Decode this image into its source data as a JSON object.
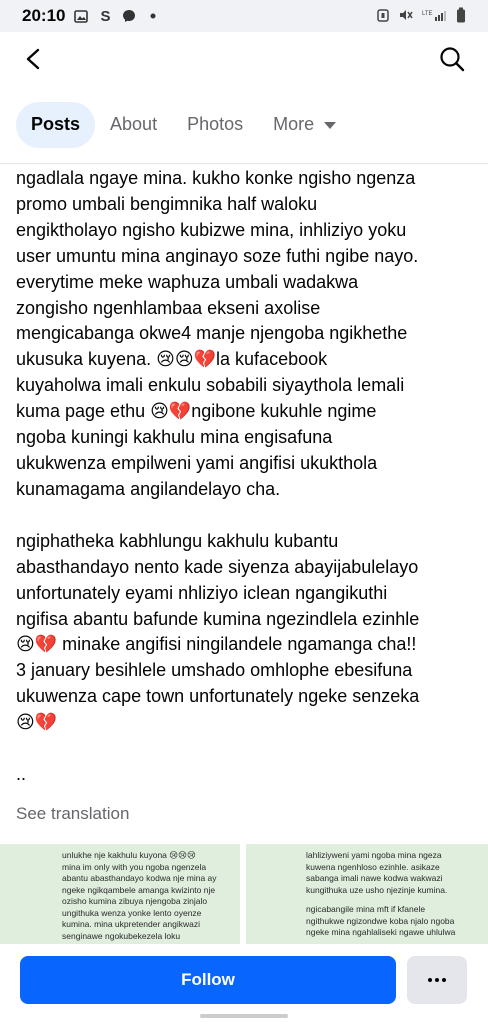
{
  "status_bar": {
    "time": "20:10",
    "s_letter": "S",
    "icons_left": [
      "gallery-icon",
      "messenger-icon",
      "dot-icon"
    ],
    "icons_right": [
      "alarm-icon",
      "mute-icon",
      "signal-bars-icon",
      "battery-icon"
    ]
  },
  "top_bar": {
    "back_icon": "back-arrow-icon",
    "search_icon": "search-icon"
  },
  "tabs": [
    {
      "label": "Posts",
      "active": true
    },
    {
      "label": "About",
      "active": false
    },
    {
      "label": "Photos",
      "active": false
    },
    {
      "label": "More",
      "active": false
    }
  ],
  "post": {
    "paragraph1_lines": [
      "ngadlala ngaye mina. kukho konke ngisho ngenza",
      "promo umbali bengimnika half waloku",
      "engiktholayo ngisho kubizwe mina, inhliziyo yoku",
      "user umuntu mina anginayo soze futhi ngibe nayo.",
      "everytime meke waphuza umbali wadakwa",
      "zongisho ngenhlambaa ekseni axolise",
      "mengicabanga okwe4 manje njengoba ngikhethe",
      "ukusuka kuyena. 😢😢💔la kufacebook",
      "kuyaholwa imali enkulu sobabili siyaythola lemali",
      "kuma page ethu 😢💔ngibone kukuhle ngime",
      "ngoba kuningi kakhulu mina engisafuna",
      "ukukwenza empilweni yami angifisi ukukthola",
      "kunamagama angilandelayo cha."
    ],
    "paragraph2_lines": [
      "ngiphatheka kabhlungu kakhulu kubantu",
      "abasthandayo nento kade siyenza abayijabulelayo",
      "unfortunately eyami nhliziyo iclean ngangikuthi",
      "ngifisa abantu bafunde kumina ngezindlela ezinhle",
      "😢💔 minake angifisi ningilandele ngamanga cha!!",
      "3 january besihlele umshado omhlophe ebesifuna",
      "ukuwenza cape town unfortunately ngeke senzeka",
      "😢💔"
    ],
    "ellipsis": "..",
    "see_translation": "See translation"
  },
  "photos": {
    "photo1_lines": [
      "unlukhe nje kakhulu kuyona 😢😢😢",
      "mina im only with you ngoba ngenzela",
      "abantu abasthandayo kodwa nje mina ay",
      "ngeke ngikqambele amanga kwizinto nje",
      "ozisho kumina zibuya njengoba zinjalo",
      "ungithuka wenza yonke lento oyenze",
      "kumina. mina ukpretender angikwazi",
      "senginawe ngokubekezela loku"
    ],
    "photo2_lines": [
      "lahliziyweni yami ngoba mina ngeza",
      "kuwena ngenhloso ezinhle. asikaze",
      "sabanga imali nawe kodwa wakwazi",
      "kungithuka uze usho njezinje kumina.",
      "",
      "ngicabangile mina mft if kfanele",
      "ngithukwe ngizondwe koba njalo ngoba",
      "ngeke mina ngahlaliseki ngawe uhlulwa"
    ]
  },
  "bottom_bar": {
    "follow_label": "Follow",
    "more_icon": "more-dots-icon"
  },
  "colors": {
    "accent": "#0866ff",
    "active_tab_bg": "#e7f0fd",
    "secondary_text": "#65676b",
    "photo_bg": "#dfeedd"
  }
}
